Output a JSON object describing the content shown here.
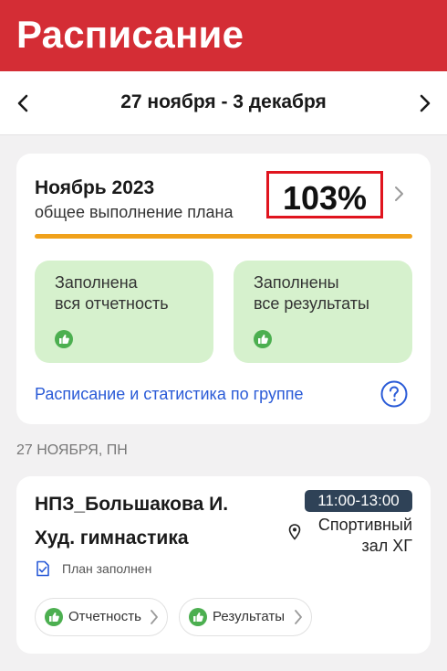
{
  "header": {
    "title": "Расписание"
  },
  "week_nav": {
    "range": "27 ноября - 3 декабря",
    "prev_icon": "chevron-left-icon",
    "next_icon": "chevron-right-icon"
  },
  "summary": {
    "month": "Ноябрь 2023",
    "subtitle": "общее выполнение плана",
    "percent_text": "103%",
    "progress_fraction": 1.0,
    "progress_color": "#f0a11b",
    "tiles": [
      {
        "line1": "Заполнена",
        "line2": "вся отчетность",
        "icon": "thumbs-up-icon"
      },
      {
        "line1": "Заполнены",
        "line2": "все результаты",
        "icon": "thumbs-up-icon"
      }
    ],
    "link": "Расписание и статистика по группе",
    "help_icon": "question-icon"
  },
  "day": {
    "header": "27 НОЯБРЯ, ПН"
  },
  "lesson": {
    "name": "НПЗ_Большакова И.",
    "sport": "Худ. гимнастика",
    "time": "11:00-13:00",
    "location_line1": "Спортивный",
    "location_line2": "зал ХГ",
    "plan_status": "План заполнен",
    "buttons": [
      {
        "label": "Отчетность"
      },
      {
        "label": "Результаты"
      }
    ]
  },
  "colors": {
    "brand_red": "#d42d35",
    "link_blue": "#2a5bd7",
    "success_green": "#4caf50",
    "tile_green": "#d6f1cd",
    "time_badge": "#2f4257"
  }
}
